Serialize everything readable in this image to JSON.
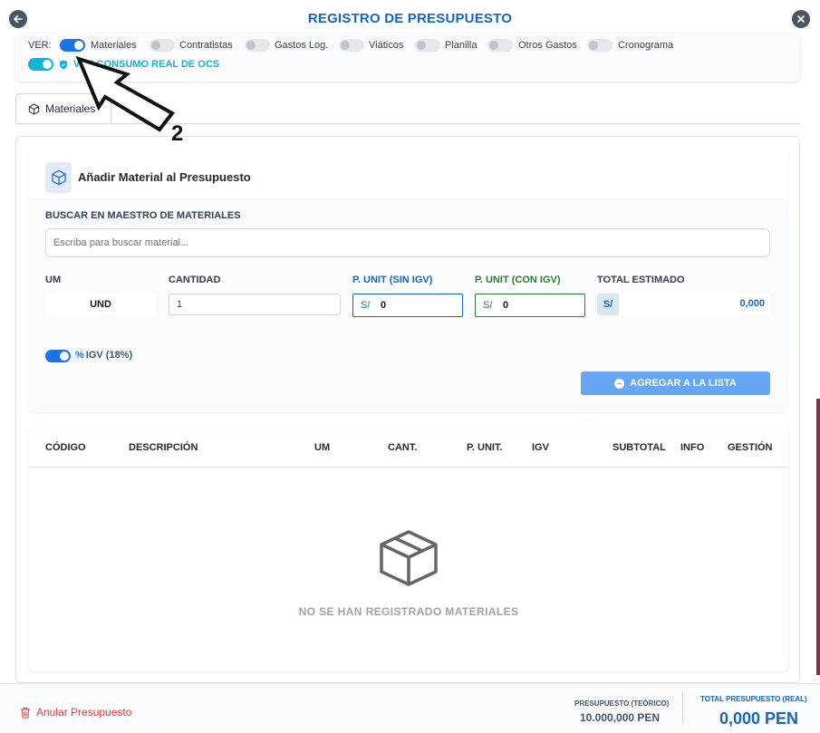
{
  "header": {
    "title": "REGISTRO DE PRESUPUESTO"
  },
  "filters": {
    "ver_label": "VER:",
    "items": [
      {
        "label": "Materiales",
        "on": true
      },
      {
        "label": "Contratistas",
        "on": false
      },
      {
        "label": "Gastos Log.",
        "on": false
      },
      {
        "label": "Viáticos",
        "on": false
      },
      {
        "label": "Planilla",
        "on": false
      },
      {
        "label": "Otros Gastos",
        "on": false
      },
      {
        "label": "Cronograma",
        "on": false
      }
    ],
    "consumo_label": "VER CONSUMO REAL DE OCS",
    "consumo_on": true
  },
  "tabs": [
    {
      "label": "Materiales",
      "active": true
    }
  ],
  "add_material": {
    "title": "Añadir Material al Presupuesto",
    "search_label": "BUSCAR EN MAESTRO DE MATERIALES",
    "search_placeholder": "Escriba para buscar material...",
    "um_label": "UM",
    "um_value": "UND",
    "cantidad_label": "CANTIDAD",
    "cantidad_value": "1",
    "punit_sin_label": "P. UNIT (SIN IGV)",
    "punit_sin_currency": "S/",
    "punit_sin_value": "0",
    "punit_con_label": "P. UNIT (CON IGV)",
    "punit_con_currency": "S/",
    "punit_con_value": "0",
    "total_label": "TOTAL ESTIMADO",
    "total_currency": "S/",
    "total_value": "0,000",
    "igv_label": "IGV (18%)",
    "igv_on": true,
    "add_button": "AGREGAR A LA LISTA"
  },
  "table": {
    "columns": [
      "CÓDIGO",
      "DESCRIPCIÓN",
      "UM",
      "CANT.",
      "P. UNIT.",
      "IGV",
      "SUBTOTAL",
      "INFO",
      "GESTIÓN"
    ],
    "rows": [],
    "empty_text": "NO SE HAN REGISTRADO MATERIALES"
  },
  "footer": {
    "annul_label": "Anular Presupuesto",
    "presupuesto_teorico_label": "PRESUPUESTO (TEÓRICO)",
    "presupuesto_teorico_value": "10.000,000 PEN",
    "total_real_label": "TOTAL PRESUPUESTO (REAL)",
    "total_real_value": "0,000 PEN"
  },
  "annotation": {
    "step_number": "2"
  },
  "colors": {
    "primary": "#1565c0",
    "toggle_on": "#1a73e8",
    "accent_cyan": "#13b5d3",
    "green": "#2e7d32",
    "danger": "#e53935"
  }
}
